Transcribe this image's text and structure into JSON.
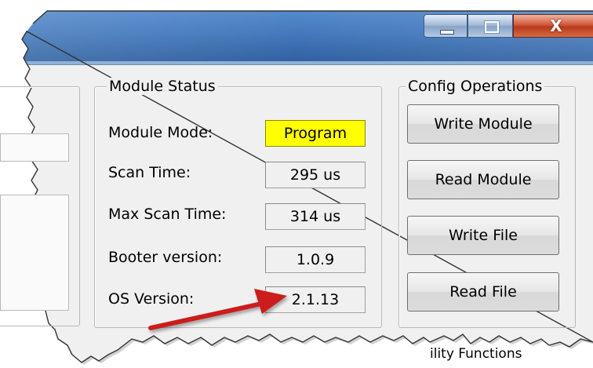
{
  "window": {
    "minimize_icon": "minimize-icon",
    "maximize_icon": "maximize-icon",
    "close_glyph": "X",
    "titlebar_color": "#3a72b8",
    "close_color": "#c7472a"
  },
  "module_status": {
    "title": "Module Status",
    "fields": [
      {
        "label": "Module Mode:",
        "value": "Program",
        "highlight": "#ffff00"
      },
      {
        "label": "Scan Time:",
        "value": "295 us"
      },
      {
        "label": "Max Scan Time:",
        "value": "314 us"
      },
      {
        "label": "Booter version:",
        "value": "1.0.9"
      },
      {
        "label": "OS Version:",
        "value": "2.1.13"
      }
    ]
  },
  "config_operations": {
    "title": "Config Operations",
    "buttons": [
      {
        "label": "Write Module"
      },
      {
        "label": "Read Module"
      },
      {
        "label": "Write File"
      },
      {
        "label": "Read File"
      }
    ]
  },
  "utility_functions": {
    "title_fragment": "ility Functions"
  },
  "annotation": {
    "arrow_color": "#cc1f1a",
    "points_to": "OS Version value"
  }
}
